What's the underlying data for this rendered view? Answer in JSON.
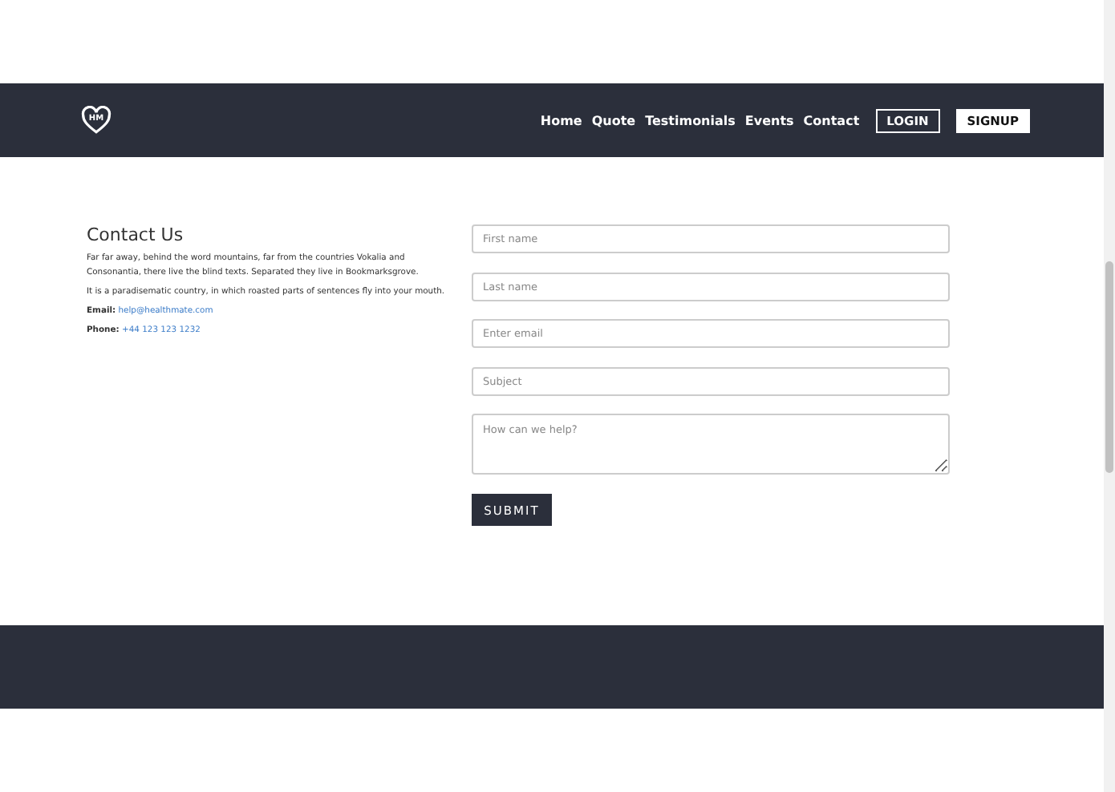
{
  "navbar": {
    "logo_text": "HM",
    "links": [
      "Home",
      "Quote",
      "Testimonials",
      "Events",
      "Contact"
    ],
    "login": "LOGIN",
    "signup": "SIGNUP"
  },
  "contact": {
    "title": "Contact Us",
    "paragraphs": [
      "Far far away, behind the word mountains, far from the countries Vokalia and Consonantia, there live the blind texts. Separated they live in Bookmarksgrove.",
      "It is a paradisematic country, in which roasted parts of sentences fly into your mouth."
    ],
    "email_label": "Email:",
    "email": "help@healthmate.com",
    "phone_label": "Phone:",
    "phone": "+44 123 123 1232"
  },
  "form": {
    "fields": [
      {
        "kind": "input",
        "placeholder": "First name"
      },
      {
        "kind": "input",
        "placeholder": "Last name"
      },
      {
        "kind": "input",
        "placeholder": "Enter email"
      },
      {
        "kind": "input",
        "placeholder": "Subject"
      },
      {
        "kind": "textarea",
        "placeholder": "How can we help?"
      }
    ],
    "submit": "SUBMIT"
  }
}
